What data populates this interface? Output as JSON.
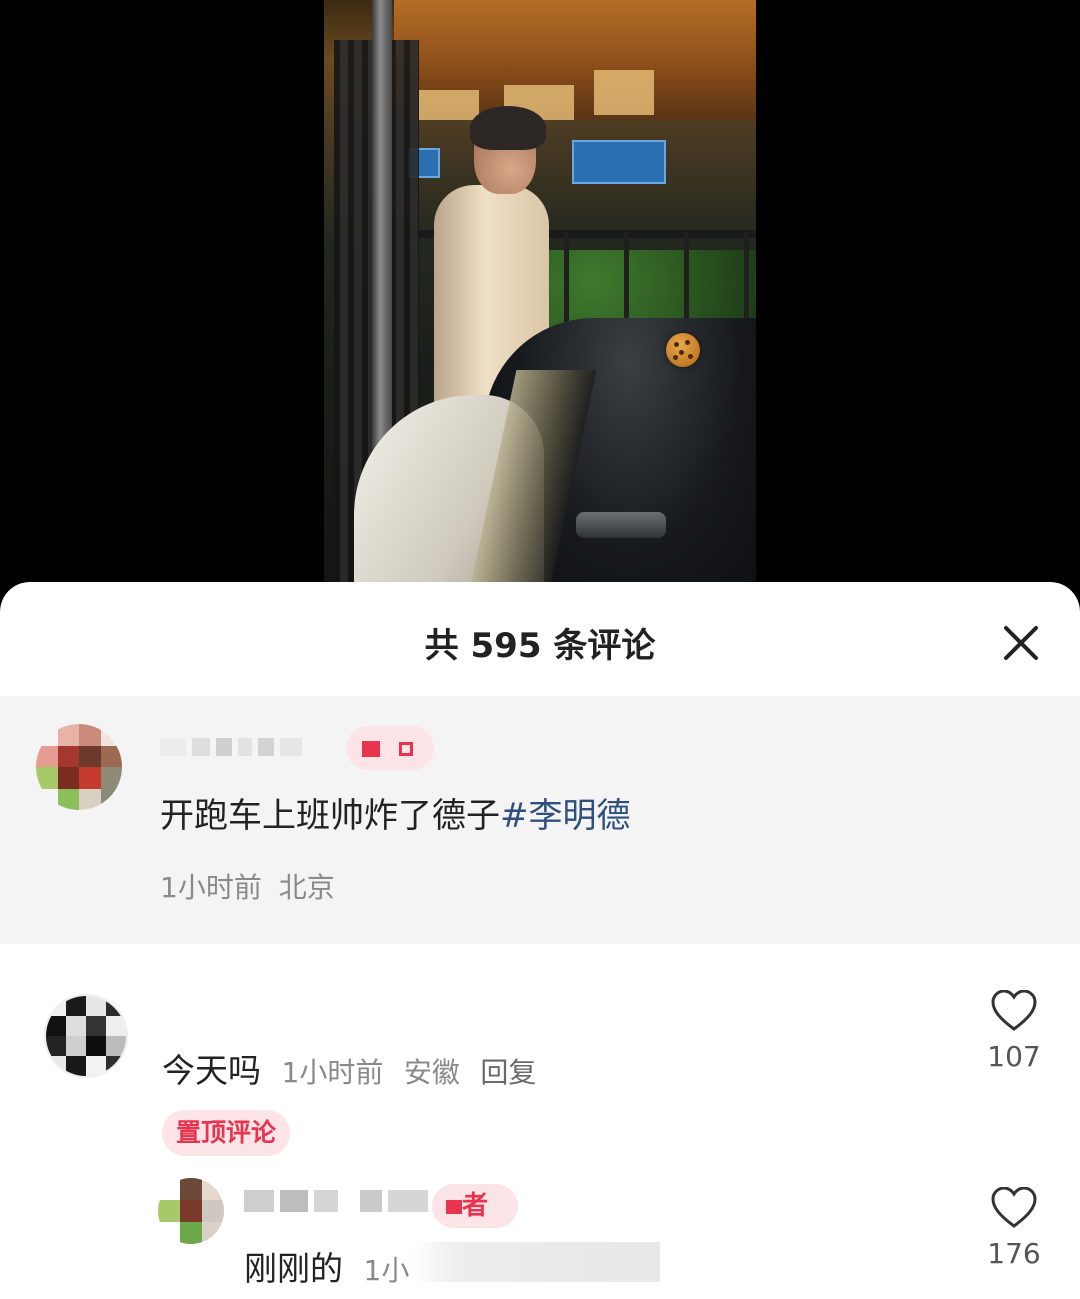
{
  "video": {
    "sticker_icon": "cookie-icon"
  },
  "comments_sheet": {
    "title": "共 595 条评论",
    "close_icon": "close-icon",
    "post": {
      "author_badge": "",
      "text_main": "开跑车上班帅炸了德子",
      "hashtag": "#李明德",
      "time": "1小时前",
      "location": "北京"
    },
    "comments": [
      {
        "text": "今天吗",
        "time": "1小时前",
        "location": "安徽",
        "reply_label": "回复",
        "likes": "107",
        "pinned_label": "置顶评论"
      }
    ],
    "replies": [
      {
        "author_badge": "者",
        "text": "刚刚的",
        "time_partial": "1小",
        "likes": "176"
      }
    ]
  },
  "colors": {
    "badge_bg": "#fde4e6",
    "badge_text": "#e8344f",
    "hashtag": "#2f4f7f",
    "post_bg": "#f4f4f4"
  }
}
